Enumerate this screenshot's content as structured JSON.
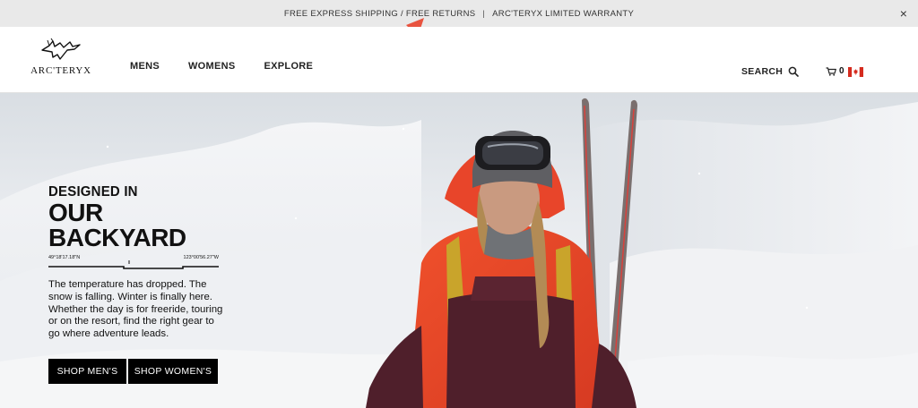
{
  "promo": {
    "shipping_text": "FREE EXPRESS SHIPPING / FREE RETURNS",
    "separator": "|",
    "warranty_text": "ARC'TERYX LIMITED WARRANTY",
    "close_label": "×"
  },
  "header": {
    "logo_text": "ARC'TERYX",
    "nav": [
      {
        "label": "MENS"
      },
      {
        "label": "WOMENS"
      },
      {
        "label": "EXPLORE"
      }
    ],
    "search_label": "SEARCH",
    "cart_count": "0",
    "region_flag": "canada-flag-icon"
  },
  "hero": {
    "heading_small": "DESIGNED IN",
    "heading_big": "OUR BACKYARD",
    "lat": "49°18'17.18\"N",
    "lon": "123°00'56.27\"W",
    "body": "The temperature has dropped. The snow is falling. Winter is finally here. Whether the day is for freeride, touring or on the resort, find the right gear to go where adventure leads.",
    "cta_mens": "SHOP MEN'S",
    "cta_womens": "SHOP WOMEN'S"
  },
  "colors": {
    "promo_bg": "#e9e9e9",
    "annotation_arrow": "#e8533f",
    "button_bg": "#000000",
    "flag_red": "#d52b1e"
  }
}
